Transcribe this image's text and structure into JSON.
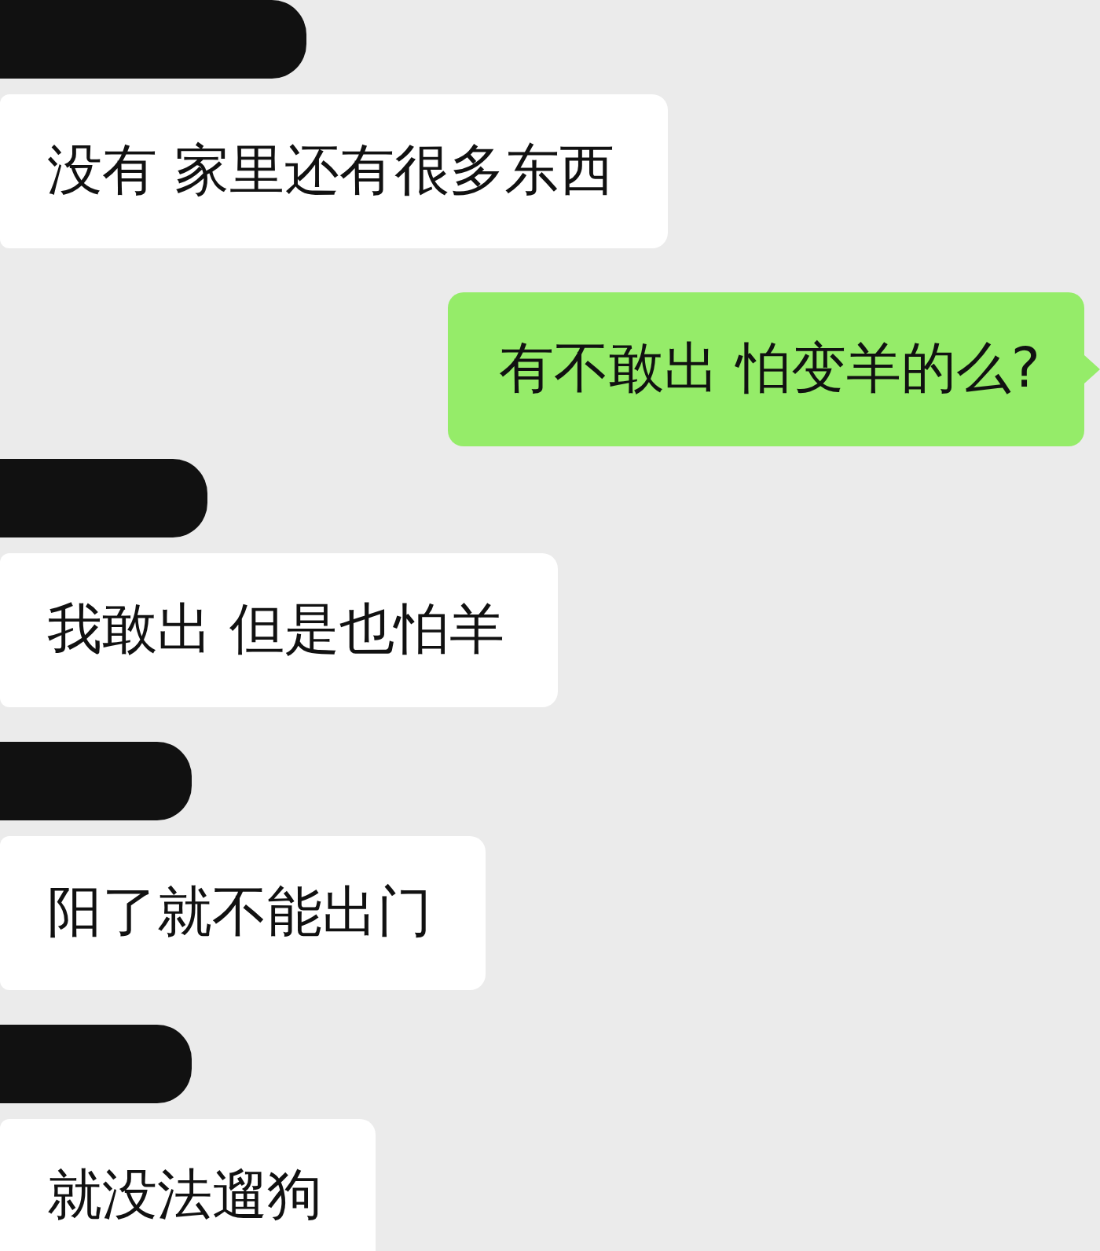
{
  "messages": [
    {
      "kind": "incoming",
      "sender_redacted": true,
      "text": "没有 家里还有很多东西"
    },
    {
      "kind": "outgoing",
      "text": "有不敢出 怕变羊的么?"
    },
    {
      "kind": "incoming",
      "sender_redacted": true,
      "text": "我敢出 但是也怕羊"
    },
    {
      "kind": "incoming",
      "sender_redacted": true,
      "text": "阳了就不能出门"
    },
    {
      "kind": "incoming",
      "sender_redacted": true,
      "text": "就没法遛狗"
    }
  ]
}
